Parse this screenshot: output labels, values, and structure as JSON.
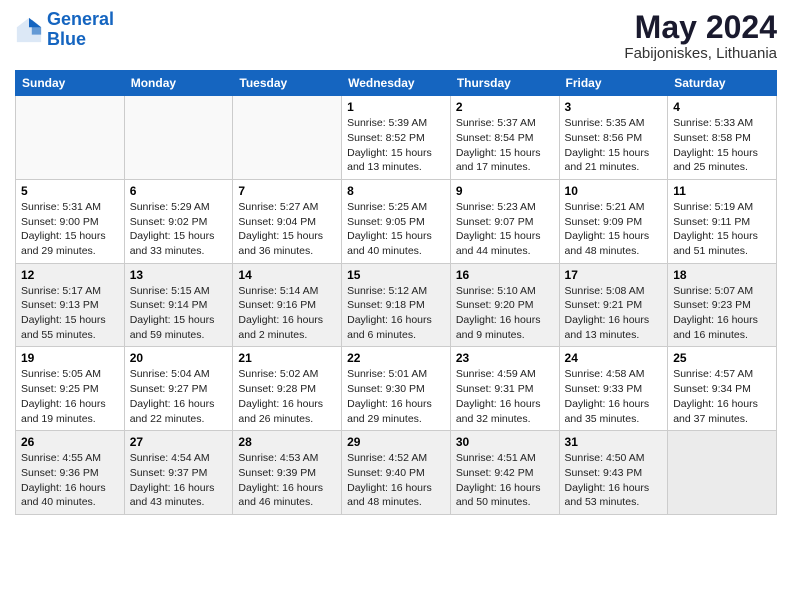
{
  "logo": {
    "line1": "General",
    "line2": "Blue"
  },
  "title": "May 2024",
  "location": "Fabijoniskes, Lithuania",
  "days_of_week": [
    "Sunday",
    "Monday",
    "Tuesday",
    "Wednesday",
    "Thursday",
    "Friday",
    "Saturday"
  ],
  "weeks": [
    {
      "shaded": false,
      "days": [
        {
          "num": "",
          "info": ""
        },
        {
          "num": "",
          "info": ""
        },
        {
          "num": "",
          "info": ""
        },
        {
          "num": "1",
          "info": "Sunrise: 5:39 AM\nSunset: 8:52 PM\nDaylight: 15 hours\nand 13 minutes."
        },
        {
          "num": "2",
          "info": "Sunrise: 5:37 AM\nSunset: 8:54 PM\nDaylight: 15 hours\nand 17 minutes."
        },
        {
          "num": "3",
          "info": "Sunrise: 5:35 AM\nSunset: 8:56 PM\nDaylight: 15 hours\nand 21 minutes."
        },
        {
          "num": "4",
          "info": "Sunrise: 5:33 AM\nSunset: 8:58 PM\nDaylight: 15 hours\nand 25 minutes."
        }
      ]
    },
    {
      "shaded": false,
      "days": [
        {
          "num": "5",
          "info": "Sunrise: 5:31 AM\nSunset: 9:00 PM\nDaylight: 15 hours\nand 29 minutes."
        },
        {
          "num": "6",
          "info": "Sunrise: 5:29 AM\nSunset: 9:02 PM\nDaylight: 15 hours\nand 33 minutes."
        },
        {
          "num": "7",
          "info": "Sunrise: 5:27 AM\nSunset: 9:04 PM\nDaylight: 15 hours\nand 36 minutes."
        },
        {
          "num": "8",
          "info": "Sunrise: 5:25 AM\nSunset: 9:05 PM\nDaylight: 15 hours\nand 40 minutes."
        },
        {
          "num": "9",
          "info": "Sunrise: 5:23 AM\nSunset: 9:07 PM\nDaylight: 15 hours\nand 44 minutes."
        },
        {
          "num": "10",
          "info": "Sunrise: 5:21 AM\nSunset: 9:09 PM\nDaylight: 15 hours\nand 48 minutes."
        },
        {
          "num": "11",
          "info": "Sunrise: 5:19 AM\nSunset: 9:11 PM\nDaylight: 15 hours\nand 51 minutes."
        }
      ]
    },
    {
      "shaded": true,
      "days": [
        {
          "num": "12",
          "info": "Sunrise: 5:17 AM\nSunset: 9:13 PM\nDaylight: 15 hours\nand 55 minutes."
        },
        {
          "num": "13",
          "info": "Sunrise: 5:15 AM\nSunset: 9:14 PM\nDaylight: 15 hours\nand 59 minutes."
        },
        {
          "num": "14",
          "info": "Sunrise: 5:14 AM\nSunset: 9:16 PM\nDaylight: 16 hours\nand 2 minutes."
        },
        {
          "num": "15",
          "info": "Sunrise: 5:12 AM\nSunset: 9:18 PM\nDaylight: 16 hours\nand 6 minutes."
        },
        {
          "num": "16",
          "info": "Sunrise: 5:10 AM\nSunset: 9:20 PM\nDaylight: 16 hours\nand 9 minutes."
        },
        {
          "num": "17",
          "info": "Sunrise: 5:08 AM\nSunset: 9:21 PM\nDaylight: 16 hours\nand 13 minutes."
        },
        {
          "num": "18",
          "info": "Sunrise: 5:07 AM\nSunset: 9:23 PM\nDaylight: 16 hours\nand 16 minutes."
        }
      ]
    },
    {
      "shaded": false,
      "days": [
        {
          "num": "19",
          "info": "Sunrise: 5:05 AM\nSunset: 9:25 PM\nDaylight: 16 hours\nand 19 minutes."
        },
        {
          "num": "20",
          "info": "Sunrise: 5:04 AM\nSunset: 9:27 PM\nDaylight: 16 hours\nand 22 minutes."
        },
        {
          "num": "21",
          "info": "Sunrise: 5:02 AM\nSunset: 9:28 PM\nDaylight: 16 hours\nand 26 minutes."
        },
        {
          "num": "22",
          "info": "Sunrise: 5:01 AM\nSunset: 9:30 PM\nDaylight: 16 hours\nand 29 minutes."
        },
        {
          "num": "23",
          "info": "Sunrise: 4:59 AM\nSunset: 9:31 PM\nDaylight: 16 hours\nand 32 minutes."
        },
        {
          "num": "24",
          "info": "Sunrise: 4:58 AM\nSunset: 9:33 PM\nDaylight: 16 hours\nand 35 minutes."
        },
        {
          "num": "25",
          "info": "Sunrise: 4:57 AM\nSunset: 9:34 PM\nDaylight: 16 hours\nand 37 minutes."
        }
      ]
    },
    {
      "shaded": true,
      "days": [
        {
          "num": "26",
          "info": "Sunrise: 4:55 AM\nSunset: 9:36 PM\nDaylight: 16 hours\nand 40 minutes."
        },
        {
          "num": "27",
          "info": "Sunrise: 4:54 AM\nSunset: 9:37 PM\nDaylight: 16 hours\nand 43 minutes."
        },
        {
          "num": "28",
          "info": "Sunrise: 4:53 AM\nSunset: 9:39 PM\nDaylight: 16 hours\nand 46 minutes."
        },
        {
          "num": "29",
          "info": "Sunrise: 4:52 AM\nSunset: 9:40 PM\nDaylight: 16 hours\nand 48 minutes."
        },
        {
          "num": "30",
          "info": "Sunrise: 4:51 AM\nSunset: 9:42 PM\nDaylight: 16 hours\nand 50 minutes."
        },
        {
          "num": "31",
          "info": "Sunrise: 4:50 AM\nSunset: 9:43 PM\nDaylight: 16 hours\nand 53 minutes."
        },
        {
          "num": "",
          "info": ""
        }
      ]
    }
  ]
}
